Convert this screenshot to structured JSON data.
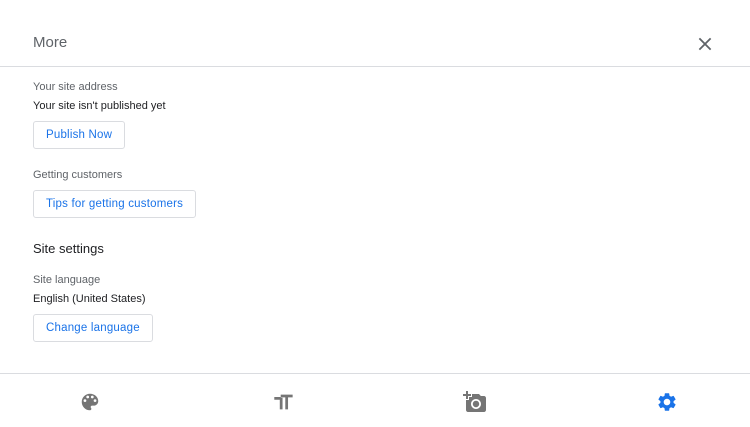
{
  "header": {
    "title": "More"
  },
  "sections": {
    "site_address": {
      "label": "Your site address",
      "value": "Your site isn't published yet",
      "button": "Publish Now"
    },
    "getting_customers": {
      "label": "Getting customers",
      "button": "Tips for getting customers"
    },
    "site_settings": {
      "heading": "Site settings",
      "language_label": "Site language",
      "language_value": "English (United States)",
      "button": "Change language"
    }
  },
  "footer": {
    "icons": [
      "palette-icon",
      "text-format-icon",
      "add-photo-icon",
      "settings-gear-icon"
    ],
    "active_index": 3
  },
  "colors": {
    "accent": "#1a73e8",
    "icon_inactive": "#757575",
    "border": "#dadce0"
  }
}
